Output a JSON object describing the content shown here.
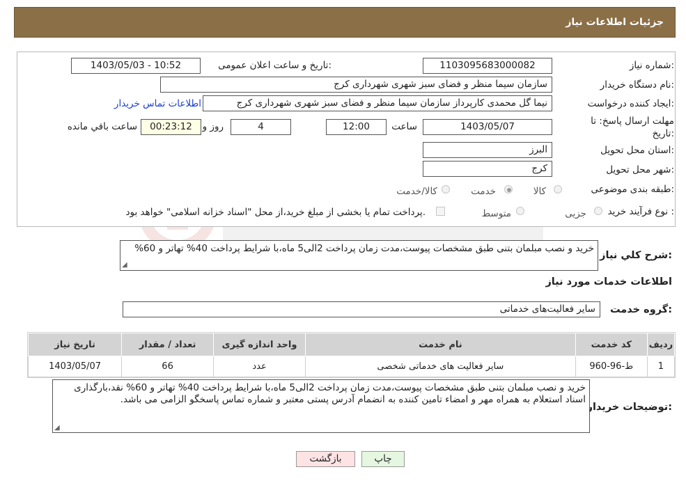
{
  "header": {
    "title": "جزئیات اطلاعات نیاز"
  },
  "form": {
    "need_number": {
      "label": "شماره نیاز:",
      "value": "1103095683000082"
    },
    "announce_datetime": {
      "label": "تاریخ و ساعت اعلان عمومی:",
      "value": "1403/05/03 - 10:52"
    },
    "buyer_org": {
      "label": "نام دستگاه خریدار:",
      "value": "سازمان سیما منظر و فضای سبز شهری شهرداری کرج"
    },
    "requester": {
      "label": "ایجاد کننده درخواست:",
      "value": "نیما گل محمدی کارپرداز سازمان سیما منظر و فضای سبز شهری شهرداری کرج"
    },
    "contact_link": "اطلاعات تماس خریدار",
    "deadline": {
      "label_line1": "مهلت ارسال پاسخ: تا",
      "label_line2": "تاریخ:",
      "date": "1403/05/07",
      "time_label": "ساعت",
      "time": "12:00",
      "days": "4",
      "days_label": "روز و",
      "remaining": "00:23:12",
      "remaining_label": "ساعت باقي مانده"
    },
    "province": {
      "label": "استان محل تحویل:",
      "value": "البرز"
    },
    "city": {
      "label": "شهر محل تحویل:",
      "value": "کرج"
    },
    "category": {
      "label": "طبقه بندی موضوعی:",
      "options": [
        "کالا",
        "خدمت",
        "کالا/خدمت"
      ],
      "selected": "خدمت"
    },
    "purchase_type": {
      "label": "نوع فرآیند خرید :",
      "options": [
        "جزیی",
        "متوسط"
      ],
      "note": "پرداخت تمام یا بخشی از مبلغ خرید،از محل \"اسناد خزانه اسلامی\" خواهد بود."
    }
  },
  "summary": {
    "label": "شرح کلي نیاز:",
    "text": "خرید و نصب مبلمان بتنی طبق مشخصات پیوست،مدت زمان پرداخت 2الی5 ماه،با شرایط پرداخت 40% تهاتر و 60%"
  },
  "services_section": {
    "title": "اطلاعات خدمات مورد نیاز",
    "group_label": "گروه خدمت:",
    "group_value": "سایر فعالیت‌های خدماتی"
  },
  "table": {
    "headers": [
      "ردیف",
      "کد خدمت",
      "نام خدمت",
      "واحد اندازه گیری",
      "تعداد / مقدار",
      "تاریخ نیاز"
    ],
    "rows": [
      [
        "1",
        "ط-96-960",
        "سایر فعالیت های خدماتی شخصی",
        "عدد",
        "66",
        "1403/05/07"
      ]
    ]
  },
  "buyer_notes": {
    "label": "توضیحات خریدار:",
    "text": "خرید و نصب مبلمان بتنی طبق مشخصات پیوست،مدت زمان پرداخت 2الی5 ماه،با شرایط پرداخت 40% تهاتر و 60% نقد،بارگذاری اسناد استعلام به همراه مهر و امضاء تامین کننده به انضمام آدرس پستی معتبر و شماره تماس پاسخگو الزامی می باشد."
  },
  "buttons": {
    "print": "چاپ",
    "back": "بازگشت"
  },
  "colors": {
    "header_bg": "#8b6f47",
    "link": "#1a3fd1",
    "back_bg": "#fde3e3",
    "print_bg": "#e5f7e0"
  },
  "icons": {
    "watermark": "aria-tender-logo"
  }
}
